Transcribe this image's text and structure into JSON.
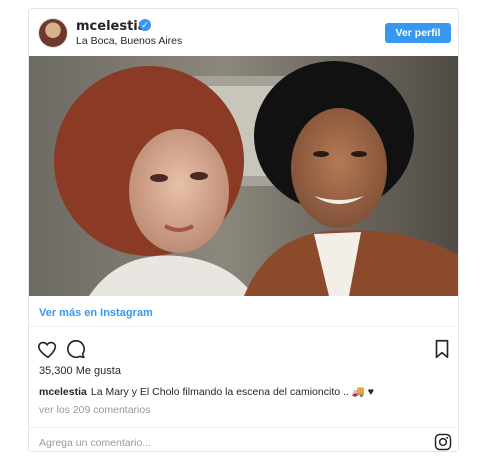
{
  "header": {
    "username": "mcelestia",
    "location": "La Boca, Buenos Aires",
    "profile_button": "Ver perfil"
  },
  "post": {
    "view_link": "Ver más en Instagram",
    "likes": "35,300 Me gusta",
    "caption_user": "mcelestia",
    "caption_text": "La Mary y El Cholo filmando la escena del camioncito .. 🚚 ♥",
    "comments_link": "ver los 209 comentarios",
    "comment_placeholder": "Agrega un comentario..."
  },
  "icons": {
    "like": "heart-icon",
    "comment": "comment-icon",
    "save": "bookmark-icon",
    "brand": "instagram-icon",
    "verified": "verified-badge-icon"
  },
  "colors": {
    "accent": "#3897f0",
    "text": "#262626",
    "muted": "#999999"
  }
}
